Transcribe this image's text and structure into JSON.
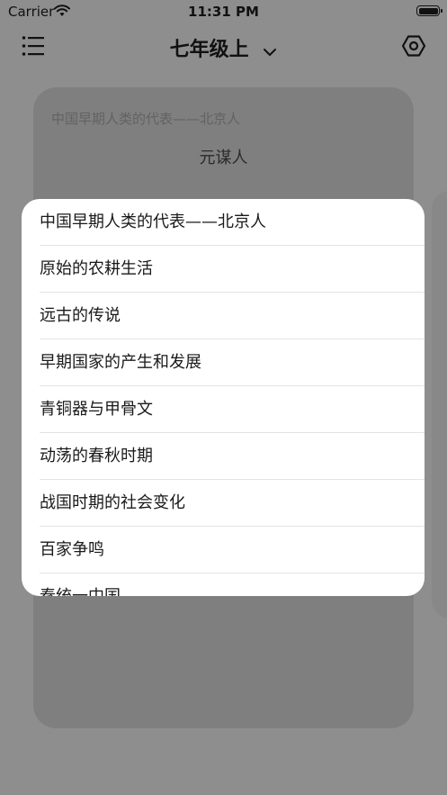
{
  "status_bar": {
    "carrier": "Carrier",
    "time": "11:31 PM"
  },
  "nav": {
    "title": "七年级上"
  },
  "card": {
    "subtitle": "中国早期人类的代表——北京人",
    "title": "元谋人"
  },
  "popup": {
    "items": [
      "中国早期人类的代表——北京人",
      "原始的农耕生活",
      "远古的传说",
      "早期国家的产生和发展",
      "青铜器与甲骨文",
      "动荡的春秋时期",
      "战国时期的社会变化",
      "百家争鸣",
      "秦统一中国"
    ]
  }
}
